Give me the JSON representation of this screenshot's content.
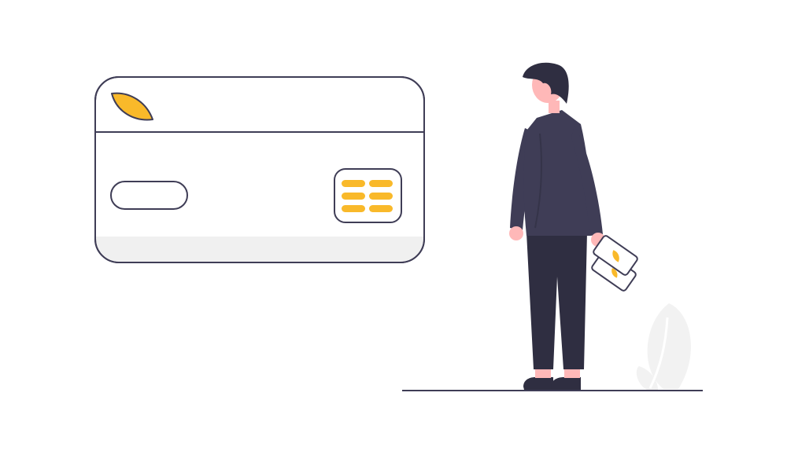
{
  "colors": {
    "background": "#ffffff",
    "outline": "#3f3d56",
    "accent": "#f9b92a",
    "card_fill": "#ffffff",
    "card_strip": "#f0f0f0",
    "suit": "#3f3d56",
    "trousers": "#2f2e41",
    "hair": "#2f2e41",
    "skin": "#ffb8b8",
    "shoes": "#2f2e41",
    "plant": "#f2f2f2",
    "ground_line": "#3f3d56"
  },
  "icons": {
    "card_logo": "leaf-logo-icon",
    "card_chip": "chip-icon",
    "held_item": "mini-cards-icon",
    "plant": "plant-leaf-icon"
  }
}
